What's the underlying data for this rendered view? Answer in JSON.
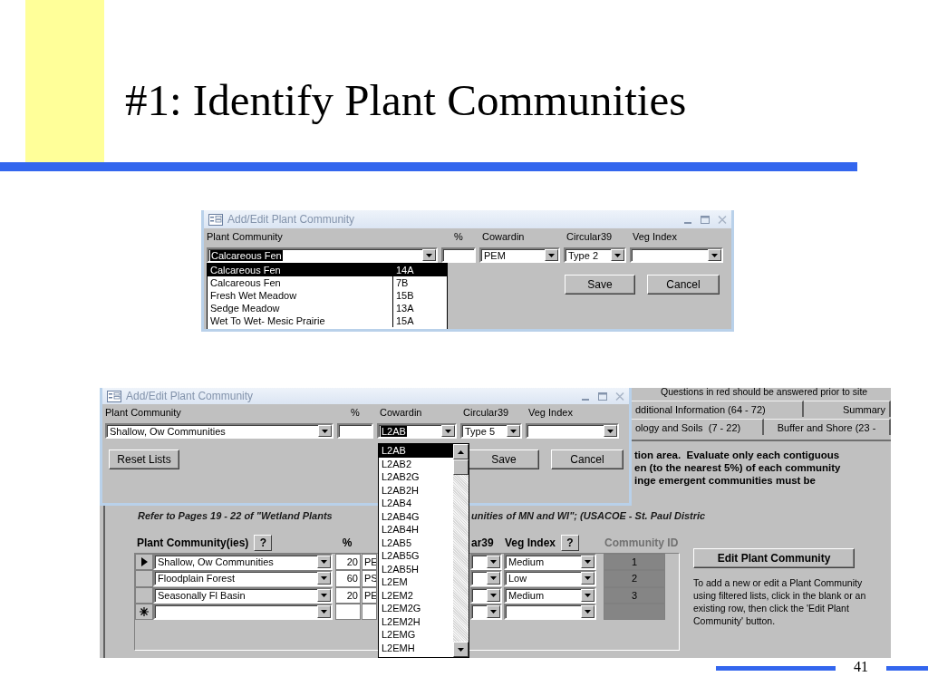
{
  "slide": {
    "title": "#1: Identify Plant Communities",
    "page_number": "41"
  },
  "dialog_1": {
    "title": "Add/Edit Plant Community",
    "labels": [
      "Plant Community",
      "%",
      "Cowardin",
      "Circular39",
      "Veg Index"
    ],
    "fields": [
      {
        "kind": "combo",
        "value": "Calcareous Fen",
        "highlighted": true
      },
      {
        "kind": "text"
      },
      {
        "kind": "combo",
        "value": "PEM",
        "highlighted": false
      },
      {
        "kind": "combo",
        "value": "Type 2",
        "highlighted": false
      },
      {
        "kind": "combo"
      }
    ],
    "buttons": [
      "Save",
      "Cancel"
    ],
    "dropdown": [
      {
        "name": "Calcareous Fen",
        "code": "14A",
        "selected": true
      },
      {
        "name": "Calcareous Fen",
        "code": "7B",
        "selected": false
      },
      {
        "name": "Fresh Wet Meadow",
        "code": "15B",
        "selected": false
      },
      {
        "name": "Sedge Meadow",
        "code": "13A",
        "selected": false
      },
      {
        "name": "Wet To Wet- Mesic Prairie",
        "code": "15A",
        "selected": false
      }
    ]
  },
  "form": {
    "notice": "Questions in red should be answered prior to site",
    "tab_rows": [
      {
        "tabs": [
          {
            "label": "dditional Information (64 - 72)",
            "selected": false
          },
          {
            "label": "Summary",
            "selected": false
          }
        ]
      },
      {
        "tabs": [
          {
            "label": "ology and Soils  (7 - 22)",
            "selected": false
          },
          {
            "label": "Buffer and Shore (23 -",
            "selected": false
          }
        ]
      }
    ],
    "instructions": [
      "tion area.  Evaluate only each contiguous",
      "en (to the nearest 5%) of each community",
      "inge emergent communities must be"
    ],
    "reference": [
      "Refer to Pages 19 - 22 of \"Wetland Plants",
      "unities of MN and WI\"; (USACOE - St. Paul Distric"
    ],
    "grid": {
      "headers": [
        {
          "label": "Plant Community(ies)",
          "help": "?",
          "disabled": false
        },
        {
          "label": "%",
          "disabled": false
        },
        {
          "label": "ar39",
          "disabled": false
        },
        {
          "label": "Veg Index",
          "help": "?",
          "disabled": false
        },
        {
          "label": "Community ID",
          "disabled": true
        }
      ],
      "rows": [
        {
          "kind": "record",
          "selected": true,
          "community": "Shallow, Ow Communities",
          "percent": "20",
          "cowardin": "PE",
          "veg_index": "Medium",
          "id": "1"
        },
        {
          "kind": "record",
          "selected": false,
          "community": "Floodplain Forest",
          "percent": "60",
          "cowardin": "PS",
          "veg_index": "Low",
          "id": "2"
        },
        {
          "kind": "record",
          "selected": false,
          "community": "Seasonally Fl Basin",
          "percent": "20",
          "cowardin": "PE",
          "veg_index": "Medium",
          "id": "3"
        },
        {
          "kind": "new",
          "selected": false
        }
      ]
    },
    "edit_button": "Edit Plant Community",
    "help_text": "To add a new or edit a Plant Community using filtered lists, click in the blank or an existing row, then click the 'Edit Plant Community' button."
  },
  "dialog_2": {
    "title": "Add/Edit Plant Community",
    "labels": [
      "Plant Community",
      "%",
      "Cowardin",
      "Circular39",
      "Veg Index"
    ],
    "fields": [
      {
        "kind": "combo",
        "value": "Shallow, Ow Communities",
        "highlighted": false
      },
      {
        "kind": "text"
      },
      {
        "kind": "combo",
        "value": "L2AB",
        "highlighted": true
      },
      {
        "kind": "combo",
        "value": "Type 5",
        "highlighted": false
      },
      {
        "kind": "combo"
      }
    ],
    "reset_button": "Reset Lists",
    "buttons": [
      "Save",
      "Cancel"
    ],
    "dropdown": [
      {
        "label": "L2AB",
        "selected": true
      },
      {
        "label": "L2AB2",
        "selected": false
      },
      {
        "label": "L2AB2G",
        "selected": false
      },
      {
        "label": "L2AB2H",
        "selected": false
      },
      {
        "label": "L2AB4",
        "selected": false
      },
      {
        "label": "L2AB4G",
        "selected": false
      },
      {
        "label": "L2AB4H",
        "selected": false
      },
      {
        "label": "L2AB5",
        "selected": false
      },
      {
        "label": "L2AB5G",
        "selected": false
      },
      {
        "label": "L2AB5H",
        "selected": false
      },
      {
        "label": "L2EM",
        "selected": false
      },
      {
        "label": "L2EM2",
        "selected": false
      },
      {
        "label": "L2EM2G",
        "selected": false
      },
      {
        "label": "L2EM2H",
        "selected": false
      },
      {
        "label": "L2EMG",
        "selected": false
      },
      {
        "label": "L2EMH",
        "selected": false
      }
    ]
  }
}
